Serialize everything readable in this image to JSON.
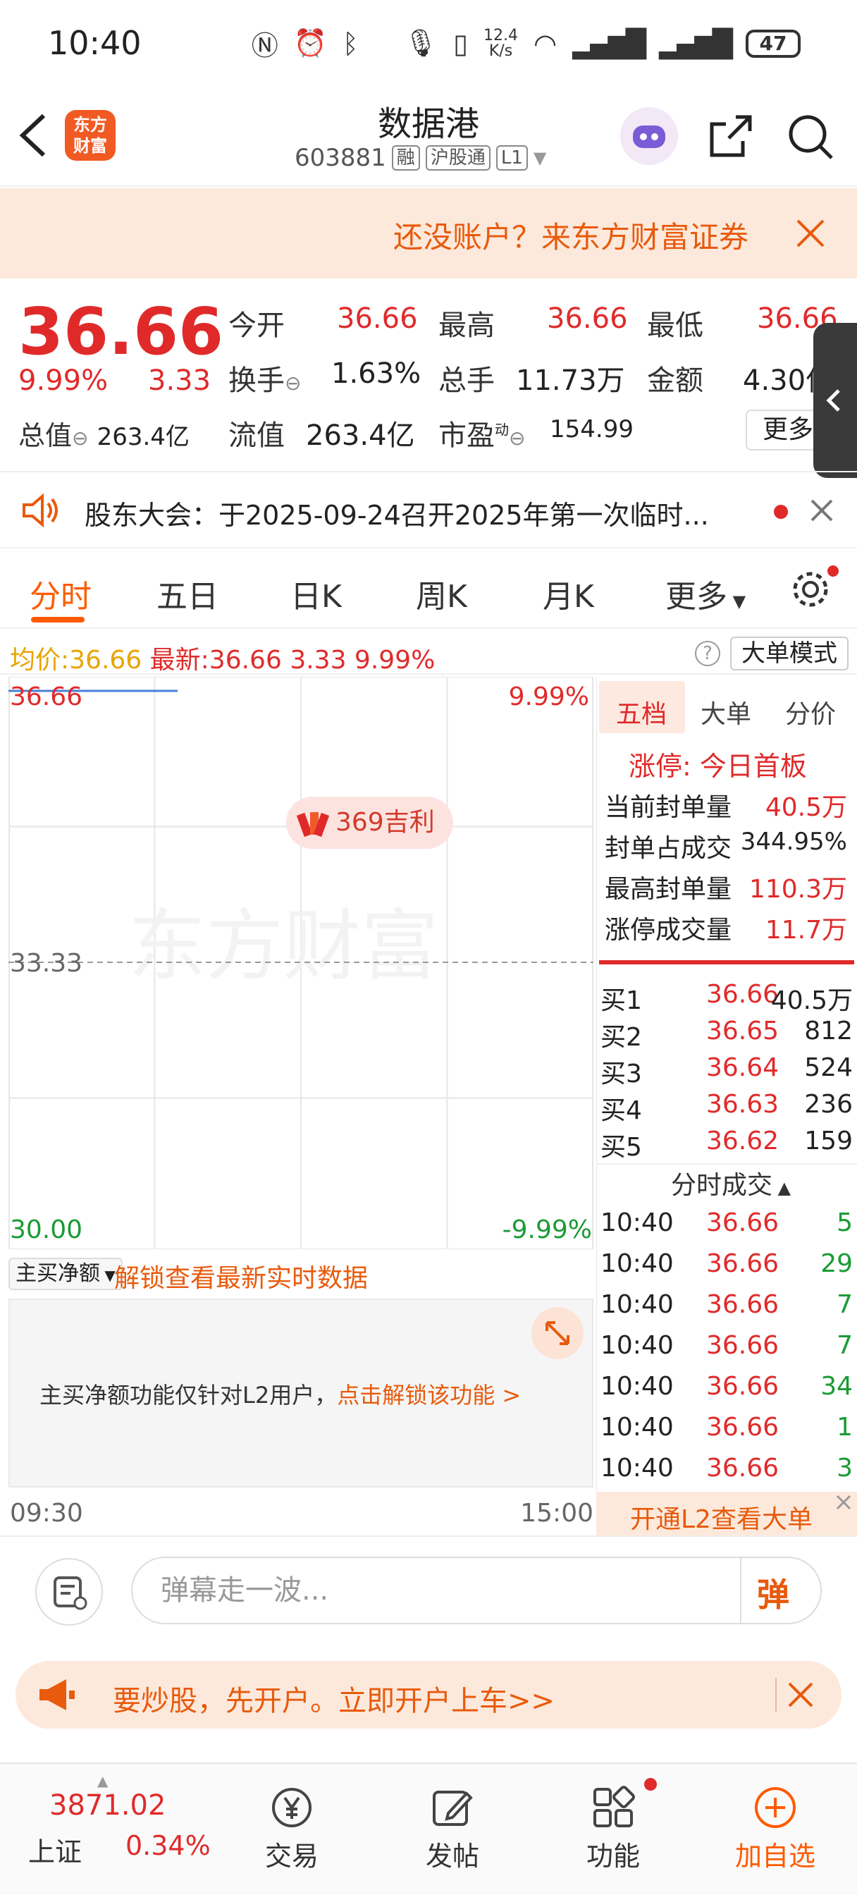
{
  "status": {
    "time": "10:40",
    "net_speed_top": "12.4",
    "net_speed_bottom": "K/s",
    "battery": "47"
  },
  "header": {
    "logo_line1": "东方",
    "logo_line2": "财富",
    "name": "数据港",
    "code": "603881",
    "tags": [
      "融",
      "沪股通",
      "L1"
    ]
  },
  "banner": {
    "text": "还没账户？来东方财富证券"
  },
  "quote": {
    "price": "36.66",
    "change_pct": "9.99%",
    "change": "3.33",
    "open_label": "今开",
    "open": "36.66",
    "high_label": "最高",
    "high": "36.66",
    "low_label": "最低",
    "low": "36.66",
    "turnover_label": "换手",
    "turnover": "1.63%",
    "volume_label": "总手",
    "volume": "11.73万",
    "amount_label": "金额",
    "amount": "4.30亿",
    "mcap_label": "总值",
    "mcap": "263.4亿",
    "float_label": "流值",
    "float": "263.4亿",
    "pe_label": "市盈",
    "pe_sup": "动",
    "pe": "154.99",
    "more": "更多"
  },
  "notice": {
    "text": "股东大会：于2025-09-24召开2025年第一次临时..."
  },
  "tabs": [
    "分时",
    "五日",
    "日K",
    "周K",
    "月K",
    "更多"
  ],
  "infoline": {
    "avg_label": "均价:",
    "avg": "36.66",
    "latest_label": "最新:",
    "latest": "36.66",
    "chg": "3.33",
    "pct": "9.99%",
    "big_mode": "大单模式"
  },
  "chart": {
    "top_price": "36.66",
    "top_pct": "9.99%",
    "mid_price": "33.33",
    "bottom_price": "30.00",
    "bottom_pct": "-9.99%",
    "badge": "369吉利",
    "watermark": "东方财富",
    "time_start": "09:30",
    "time_end": "15:00"
  },
  "chart_data": {
    "type": "line",
    "x": [
      "09:30",
      "10:40"
    ],
    "series": [
      {
        "values": [
          36.66,
          36.66
        ]
      }
    ],
    "ylim": [
      30.0,
      36.66
    ],
    "yticks": [
      "36.66",
      "33.33",
      "30.00"
    ],
    "ytick_pct": [
      "9.99%",
      "-9.99%"
    ],
    "xticks": [
      "09:30",
      "15:00"
    ]
  },
  "l2": {
    "select": "主买净额",
    "unlock": "解锁查看最新实时数据",
    "msg": "主买净额功能仅针对L2用户，",
    "link": "点击解锁该功能 >"
  },
  "rpanel": {
    "tabs": [
      "五档",
      "大单",
      "分价"
    ],
    "limit_label": "涨停:",
    "limit_value": "今日首板",
    "stats": [
      {
        "label": "当前封单量",
        "value": "40.5万"
      },
      {
        "label": "封单占成交",
        "value": "344.95%"
      },
      {
        "label": "最高封单量",
        "value": "110.3万"
      },
      {
        "label": "涨停成交量",
        "value": "11.7万"
      }
    ],
    "bids": [
      {
        "label": "买1",
        "price": "36.66",
        "qty": "40.5万"
      },
      {
        "label": "买2",
        "price": "36.65",
        "qty": "812"
      },
      {
        "label": "买3",
        "price": "36.64",
        "qty": "524"
      },
      {
        "label": "买4",
        "price": "36.63",
        "qty": "236"
      },
      {
        "label": "买5",
        "price": "36.62",
        "qty": "159"
      }
    ],
    "ticks_title": "分时成交",
    "ticks": [
      {
        "time": "10:40",
        "price": "36.66",
        "qty": "5"
      },
      {
        "time": "10:40",
        "price": "36.66",
        "qty": "29"
      },
      {
        "time": "10:40",
        "price": "36.66",
        "qty": "7"
      },
      {
        "time": "10:40",
        "price": "36.66",
        "qty": "7"
      },
      {
        "time": "10:40",
        "price": "36.66",
        "qty": "34"
      },
      {
        "time": "10:40",
        "price": "36.66",
        "qty": "1"
      },
      {
        "time": "10:40",
        "price": "36.66",
        "qty": "3"
      }
    ],
    "l2_link": "开通L2查看大单"
  },
  "comment": {
    "placeholder": "弹幕走一波...",
    "danmu_btn": "弹"
  },
  "promo": {
    "text": "要炒股，先开户。立即开户上车>>"
  },
  "nav": {
    "index_value": "3871.02",
    "index_name": "上证",
    "index_pct": "0.34%",
    "items": [
      "交易",
      "发帖",
      "功能",
      "加自选"
    ]
  },
  "colors": {
    "up": "#e02a2a",
    "down": "#1a9b35",
    "accent": "#ff5a00",
    "banner_bg": "#fde9dc"
  }
}
